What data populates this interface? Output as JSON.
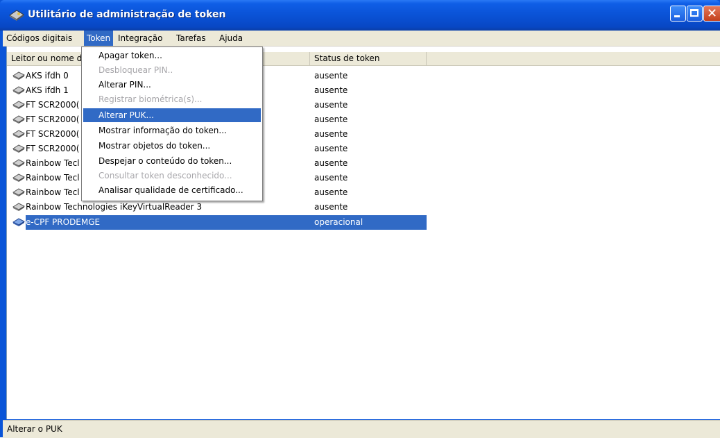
{
  "window": {
    "title": "Utilitário de administração de token",
    "colors": {
      "titlebar": "#0a52d6",
      "selection": "#316ac5",
      "menubar": "#ece9d8"
    }
  },
  "menubar": [
    "Códigos digitais",
    "Token",
    "Integração",
    "Tarefas",
    "Ajuda"
  ],
  "token_menu": [
    {
      "label": "Apagar token...",
      "state": "enabled"
    },
    {
      "label": "Desbloquear PIN..",
      "state": "disabled"
    },
    {
      "label": "Alterar PIN...",
      "state": "enabled"
    },
    {
      "label": "Registrar biométrica(s)...",
      "state": "disabled"
    },
    {
      "label": "Alterar PUK...",
      "state": "highlighted"
    },
    {
      "label": "Mostrar informação do token...",
      "state": "enabled"
    },
    {
      "label": "Mostrar objetos do token...",
      "state": "enabled"
    },
    {
      "label": "Despejar o conteúdo do token...",
      "state": "enabled"
    },
    {
      "label": "Consultar token desconhecido...",
      "state": "disabled"
    },
    {
      "label": "Analisar qualidade de certificado...",
      "state": "enabled"
    }
  ],
  "list": {
    "headers": {
      "name": "Leitor ou nome d",
      "status": "Status de token"
    },
    "rows": [
      {
        "name": "AKS ifdh 0",
        "status": "ausente"
      },
      {
        "name": "AKS ifdh 1",
        "status": "ausente"
      },
      {
        "name": "FT SCR2000(",
        "status": "ausente"
      },
      {
        "name": "FT SCR2000(",
        "status": "ausente"
      },
      {
        "name": "FT SCR2000(",
        "status": "ausente"
      },
      {
        "name": "FT SCR2000(",
        "status": "ausente"
      },
      {
        "name": "Rainbow Tecl",
        "status": "ausente"
      },
      {
        "name": "Rainbow Tecl",
        "status": "ausente"
      },
      {
        "name": "Rainbow Tecl",
        "status": "ausente"
      },
      {
        "name": "Rainbow Technologies iKeyVirtualReader 3",
        "status": "ausente"
      },
      {
        "name": "e-CPF PRODEMGE",
        "status": "operacional",
        "selected": true
      }
    ]
  },
  "statusbar": {
    "text": "Alterar o PUK"
  }
}
